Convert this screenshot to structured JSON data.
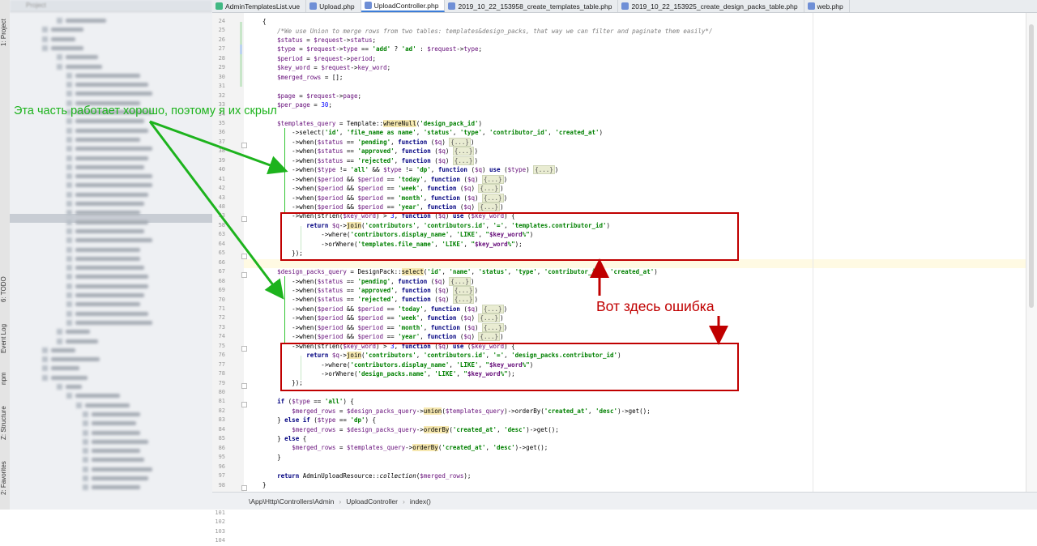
{
  "sidebar_tabs": [
    "1: Project",
    "6: TODO",
    "Event Log",
    "npm",
    "Z: Structure",
    "2: Favorites"
  ],
  "tabs": [
    {
      "label": "AdminTemplatesList.vue",
      "icon_color": "#41b883",
      "active": false
    },
    {
      "label": "Upload.php",
      "icon_color": "#6f8fd6",
      "active": false
    },
    {
      "label": "UploadController.php",
      "icon_color": "#6f8fd6",
      "active": true
    },
    {
      "label": "2019_10_22_153958_create_templates_table.php",
      "icon_color": "#6f8fd6",
      "active": false
    },
    {
      "label": "2019_10_22_153925_create_design_packs_table.php",
      "icon_color": "#6f8fd6",
      "active": false
    },
    {
      "label": "web.php",
      "icon_color": "#6f8fd6",
      "active": false
    }
  ],
  "line_numbers": [
    "24",
    "25",
    "26",
    "27",
    "28",
    "29",
    "30",
    "31",
    "32",
    "33",
    "34",
    "35",
    "36",
    "37",
    "38",
    "39",
    "40",
    "41",
    "42",
    "43",
    "48",
    "53",
    "58",
    "63",
    "64",
    "65",
    "66",
    "67",
    "68",
    "69",
    "70",
    "71",
    "72",
    "73",
    "74",
    "75",
    "76",
    "77",
    "78",
    "79",
    "80",
    "81",
    "82",
    "83",
    "84",
    "85",
    "86",
    "95",
    "96",
    "97",
    "98",
    "99",
    "100",
    "101",
    "102",
    "103",
    "104"
  ],
  "breadcrumb": [
    "\\App\\Http\\Controllers\\Admin",
    "UploadController",
    "index()"
  ],
  "annotation_top": "Эта часть работает хорошо, поэтому я их скрыл",
  "annotation_error": "Вот здесь ошибка",
  "colors": {
    "annotation_green": "#1db31d",
    "annotation_red": "#c00000",
    "keyword": "#000080",
    "variable": "#660e7a",
    "string": "#008000"
  }
}
